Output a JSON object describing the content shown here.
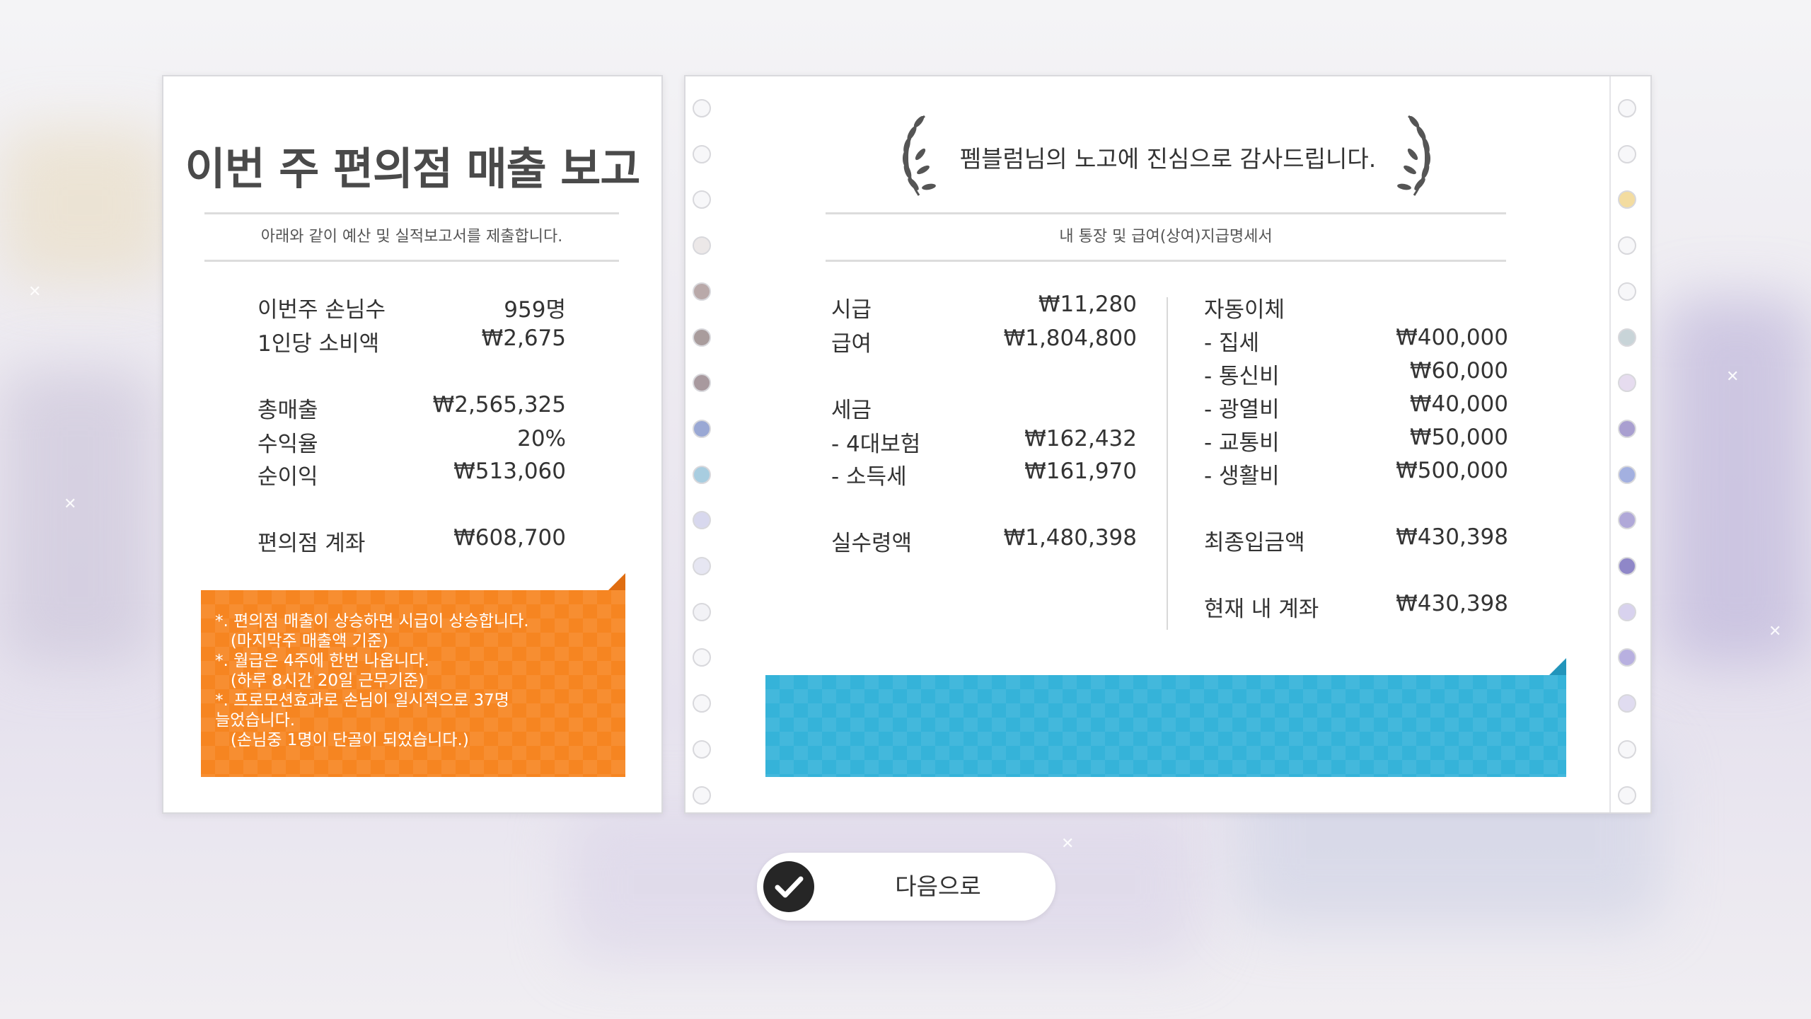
{
  "report": {
    "title": "이번 주 편의점 매출 보고",
    "subtitle": "아래와 같이 예산 및 실적보고서를 제출합니다.",
    "rows": [
      {
        "label": "이번주 손님수",
        "value": "959명"
      },
      {
        "label": "1인당 소비액",
        "value": "₩2,675"
      },
      {
        "label": "총매출",
        "value": "₩2,565,325"
      },
      {
        "label": "수익율",
        "value": "20%"
      },
      {
        "label": "순이익",
        "value": "₩513,060"
      },
      {
        "label": "편의점 계좌",
        "value": "₩608,700"
      }
    ],
    "note": "*. 편의점 매출이 상승하면 시급이 상승합니다.\n   (마지막주 매출액 기준)\n*. 월급은 4주에 한번 나옵니다.\n   (하루 8시간 20일 근무기준)\n*. 프로모션효과로 손님이 일시적으로 37명\n늘었습니다.\n   (손님중 1명이 단골이 되었습니다.)",
    "note_color": "#f68521"
  },
  "payslip": {
    "thanks": "펨블럼님의 노고에 진심으로 감사드립니다.",
    "subtitle": "내 통장 및 급여(상여)지급명세서",
    "left_rows": [
      {
        "label": "시급",
        "value": "₩11,280"
      },
      {
        "label": "급여",
        "value": "₩1,804,800"
      },
      {
        "label": "세금",
        "value": ""
      },
      {
        "label": "- 4대보험",
        "value": "₩162,432"
      },
      {
        "label": "- 소득세",
        "value": "₩161,970"
      },
      {
        "label": "실수령액",
        "value": "₩1,480,398"
      }
    ],
    "right_rows": [
      {
        "label": "자동이체",
        "value": ""
      },
      {
        "label": "- 집세",
        "value": "₩400,000"
      },
      {
        "label": "- 통신비",
        "value": "₩60,000"
      },
      {
        "label": "- 광열비",
        "value": "₩40,000"
      },
      {
        "label": "- 교통비",
        "value": "₩50,000"
      },
      {
        "label": "- 생활비",
        "value": "₩500,000"
      },
      {
        "label": "최종입금액",
        "value": "₩430,398"
      },
      {
        "label": "현재 내 계좌",
        "value": "₩430,398"
      }
    ],
    "box_color": "#35b3d9"
  },
  "next_button": {
    "label": "다음으로",
    "icon": "check-icon"
  }
}
